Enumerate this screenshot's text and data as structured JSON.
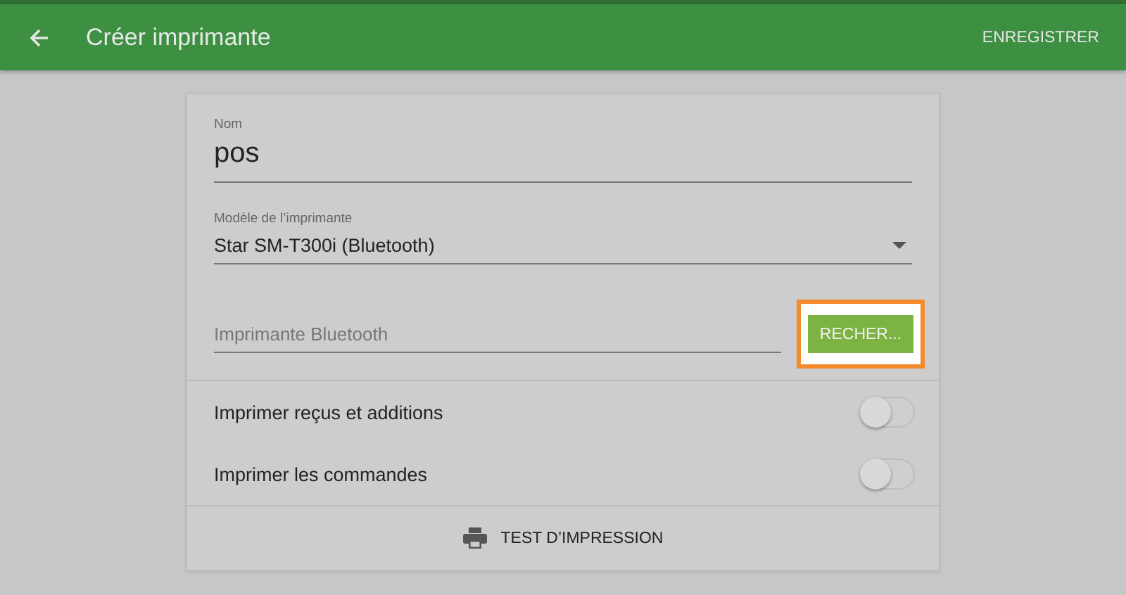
{
  "app_bar": {
    "title": "Créer imprimante",
    "action": "ENREGISTRER"
  },
  "form": {
    "name_field": {
      "label": "Nom",
      "value": "pos"
    },
    "model_field": {
      "label": "Modèle de l’imprimante",
      "value": "Star SM-T300i (Bluetooth)"
    },
    "bluetooth_field": {
      "placeholder": "Imprimante Bluetooth"
    },
    "search_button": {
      "label": "RECHER...",
      "highlighted": true
    }
  },
  "toggles": [
    {
      "label": "Imprimer reçus et additions",
      "on": false
    },
    {
      "label": "Imprimer les commandes",
      "on": false
    }
  ],
  "test_button": {
    "label": "TEST D’IMPRESSION"
  }
}
